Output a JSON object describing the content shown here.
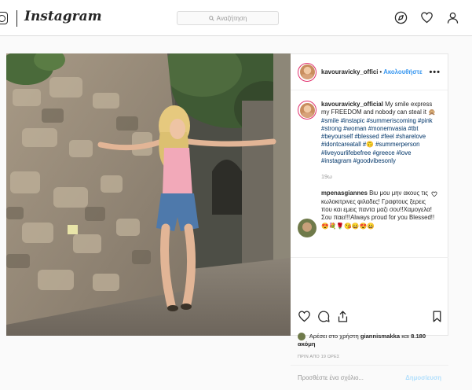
{
  "topbar": {
    "brand": "Instagram",
    "search_placeholder": "Αναζήτηση"
  },
  "post": {
    "username": "kavouravicky_offici",
    "follow_label": "Ακολουθήστε",
    "more_label": "•••",
    "caption_user": "kavouravicky_official",
    "caption_text": "My smile express my FREEDOM and nobody can steal it 🙊",
    "caption_tags": "#smile #instapic #summeriscoming #pink #strong #woman #monemvasia #tbt #beyourself #blessed #feel #sharelove #idontcareatall #🙃 #summerperson #liveyourlifebefree #greece #love #instagram #goodvibesonly",
    "caption_time": "19ω",
    "reply_user": "mpenasgiannes",
    "reply_text": "Βιυ μου μην ακους τις κωλοκιτρινες φιλαδες! Γραφτους ξερεις που και εμεις παντα μαζι σου!!Χαμογελα! Σου παει!!!Always proud for you Blessed!!😍💐🌹😘😀😍😀",
    "likes_prefix": "Αρέσει στο χρήστη",
    "likes_user": "giannismakka",
    "likes_conj": "και",
    "likes_count": "8.180 ακόμη",
    "date_text": "ΠΡΙΝ ΑΠΟ 19 ΩΡΕΣ",
    "comment_placeholder": "Προσθέστε ένα σχόλιο...",
    "post_label": "Δημοσίευση"
  },
  "colors": {
    "link_blue": "#3897f0",
    "tag_blue": "#003569",
    "disabled_blue": "#b2dffc",
    "story_ring": "#e1306c"
  }
}
